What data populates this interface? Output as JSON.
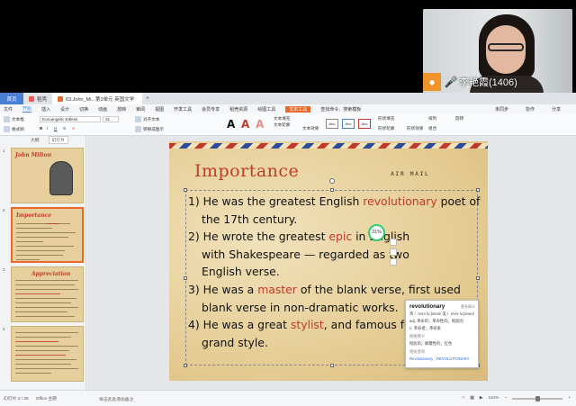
{
  "video": {
    "participant_name": "李艳霞(1406)"
  },
  "tabs": [
    {
      "label": "首页"
    },
    {
      "label": "稻壳"
    },
    {
      "label": "03.John_Mi...第3单元 英国文学"
    }
  ],
  "menu": {
    "items": [
      "文件",
      "开始",
      "插入",
      "设计",
      "切换",
      "动画",
      "放映",
      "审阅",
      "视图",
      "开发工具",
      "会员专享",
      "稻壳资源",
      "绘图工具",
      "文本工具"
    ],
    "search": "查找命令、搜索模板",
    "right": [
      "未同步",
      "协作",
      "分享"
    ]
  },
  "ribbon": {
    "font_name": "Euroangelic Edless",
    "font_size": "31",
    "labels": [
      "文本框",
      "格式刷",
      "对齐文本",
      "转换成图示",
      "文本填充",
      "文本轮廓",
      "文本效果",
      "形状填充",
      "形状轮廓",
      "形状效果",
      "排列",
      "组合",
      "旋转"
    ],
    "shape_labels": [
      "Abc",
      "Abc",
      "Abc"
    ]
  },
  "panel": {
    "tabs": [
      "大纲",
      "幻灯片"
    ],
    "thumbs": [
      {
        "num": "1",
        "title": "John Milton"
      },
      {
        "num": "2",
        "title": "Importance"
      },
      {
        "num": "3",
        "title": "Appreciation"
      },
      {
        "num": "4",
        "title": ""
      }
    ]
  },
  "slide": {
    "title": "Importance",
    "stamp": "AIR MAIL",
    "p1_a": "1) He was the greatest English ",
    "p1_hl": "revolutionary",
    "p1_b": " poet of",
    "p1_c": "the 17th century.",
    "p2_a": "2) He wrote the greatest ",
    "p2_hl": "epic",
    "p2_b": " in English",
    "p2_c": "with Shakespeare —  regarded as two",
    "p2_d": "English verse.",
    "p3_a": "3) He was a ",
    "p3_hl": "master",
    "p3_b": " of the blank verse, first used",
    "p3_c": "blank verse in non-dramatic works.",
    "p4_a": "4) He was a great ",
    "p4_hl": "stylist",
    "p4_b": ", and famous for his",
    "p4_c": "grand   style."
  },
  "badge": {
    "value": "31%"
  },
  "dict": {
    "word": "revolutionary",
    "more": "更多释义",
    "pron": "英 / ˌrevəˈluːʃənəri/   美 / ˌrevəˈluːʃəneri/",
    "def1": "adj. 革命的；革命性的，彻底的",
    "def2": "n. 革命者；革命家",
    "sub_label": "网络释义",
    "def3": "彻底的；颠覆性的；红色",
    "sub_label2": "相关查询",
    "link": "Revolutionary ; REVOLUTIONARY"
  },
  "status": {
    "slide": "幻灯片 2 / 26",
    "theme": "Office 主题",
    "notes": "单击此处添加备注",
    "zoom": "110%"
  }
}
